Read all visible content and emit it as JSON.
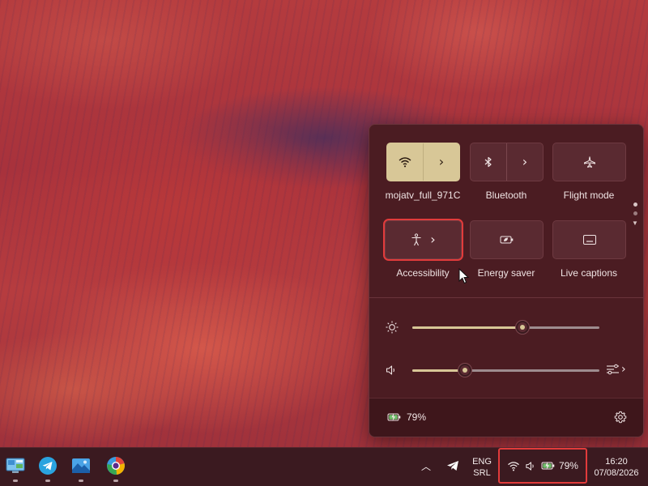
{
  "wallpaper": {
    "description_colors": [
      "#b43b3e",
      "#5b2f55"
    ]
  },
  "quick_settings": {
    "tiles": [
      {
        "label": "mojatv_full_971C",
        "icon": "wifi-icon",
        "state": "on",
        "split": true
      },
      {
        "label": "Bluetooth",
        "icon": "bluetooth-icon",
        "state": "off",
        "split": true
      },
      {
        "label": "Flight mode",
        "icon": "airplane-icon",
        "state": "off",
        "split": false
      },
      {
        "label": "Accessibility",
        "icon": "accessibility-icon",
        "state": "off",
        "split": false,
        "chevron": true
      },
      {
        "label": "Energy saver",
        "icon": "battery-leaf-icon",
        "state": "off",
        "split": false
      },
      {
        "label": "Live captions",
        "icon": "captions-icon",
        "state": "off",
        "split": false
      }
    ],
    "brightness": {
      "icon": "sun-icon",
      "value": 0.59
    },
    "volume": {
      "icon": "speaker-icon",
      "value": 0.28,
      "output_icon": "audio-output-icon"
    },
    "battery": {
      "text": "79%",
      "icon": "battery-charging-icon"
    },
    "settings_icon": "gear-icon",
    "page_indicator": {
      "pages": 2,
      "current": 1
    }
  },
  "taskbar": {
    "apps": [
      {
        "name": "control-panel",
        "icon": "monitor-icon"
      },
      {
        "name": "telegram",
        "icon": "telegram-icon"
      },
      {
        "name": "photos",
        "icon": "photos-icon"
      },
      {
        "name": "browser",
        "icon": "browser-icon"
      }
    ],
    "language": {
      "line1": "ENG",
      "line2": "SRL"
    },
    "battery_text": "79%",
    "time": "16:20",
    "date": "07/08/2026"
  },
  "colors": {
    "accent": "#d8c797",
    "panel": "#4b1c22",
    "highlight": "#e23b3b",
    "taskbar": "#3b1a20"
  }
}
